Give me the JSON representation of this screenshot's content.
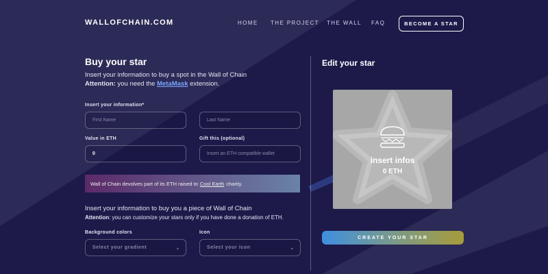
{
  "header": {
    "logo": "WALLOFCHAIN.COM",
    "nav": [
      "HOME",
      "THE PROJECT",
      "THE WALL",
      "FAQ"
    ],
    "cta": "BECOME A STAR"
  },
  "buy": {
    "title": "Buy your star",
    "intro": "Insert your information to buy a spot in the Wall of Chain",
    "attention_label": "Attention:",
    "attention_pre": "you need the",
    "attention_link": "MetaMask",
    "attention_post": "extension.",
    "info_label": "Insert your information*",
    "first_name_placeholder": "First Name",
    "last_name_placeholder": "Last Name",
    "value_label": "Value in ETH",
    "value": "0",
    "gift_label": "Gift this (optional)",
    "gift_placeholder": "Insert an ETH compatible wallet",
    "banner_pre": "Wall of Chain devolves part of its ETH raised to",
    "banner_link": "Cool Earth",
    "banner_post": "charity.",
    "piece_intro": "Insert your information to buy you a piece of Wall of Chain",
    "piece_attention_label": "Attention",
    "piece_attention_text": ": you can customize your stars only if you have done a donation of ETH.",
    "bg_label": "Background colors",
    "bg_placeholder": "Select your gradient",
    "icon_label": "Icon",
    "icon_placeholder": "Select your icon"
  },
  "edit": {
    "title": "Edit your star",
    "star_name": "insert infos",
    "star_value": "0 ETH",
    "icon": "burger-icon",
    "button": "CREATE YOUR STAR"
  }
}
